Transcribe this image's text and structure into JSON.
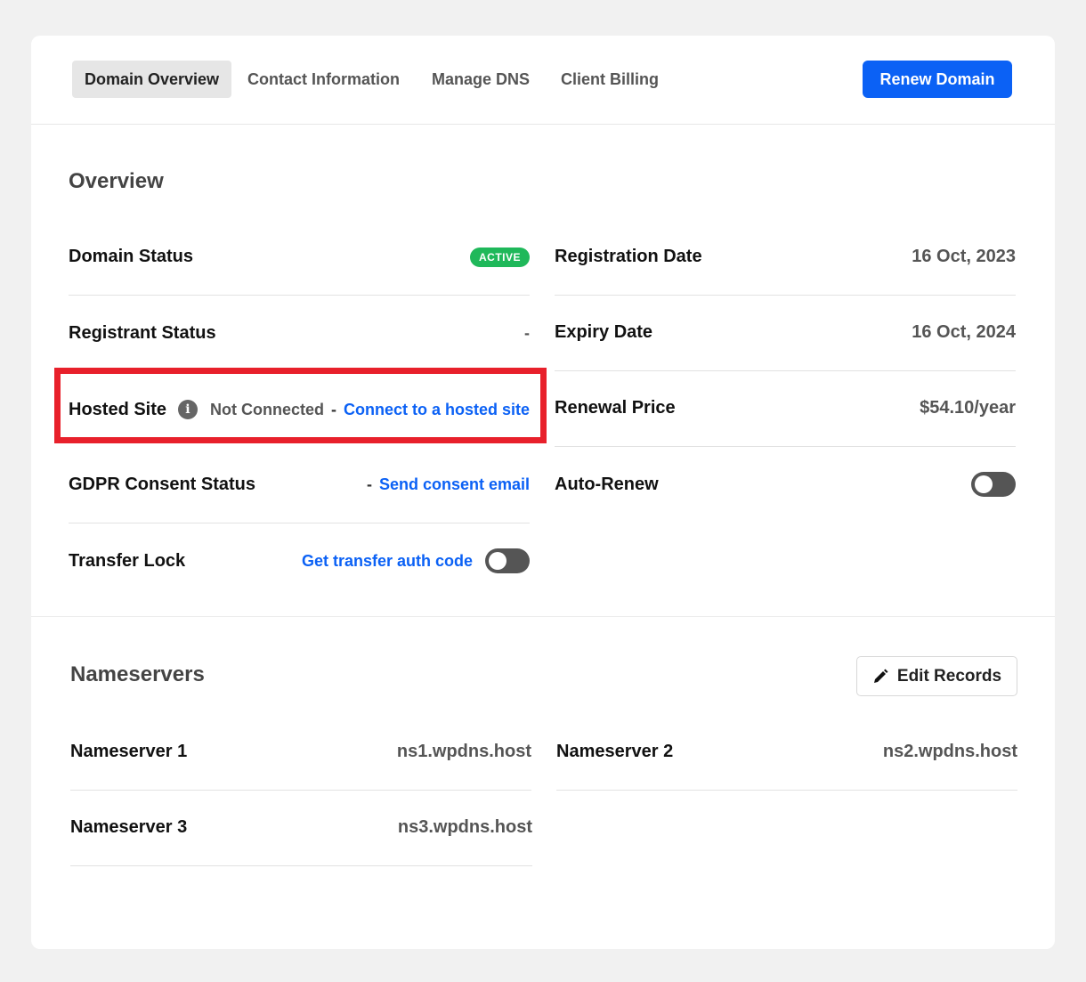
{
  "tabs": [
    {
      "label": "Domain Overview"
    },
    {
      "label": "Contact Information"
    },
    {
      "label": "Manage DNS"
    },
    {
      "label": "Client Billing"
    }
  ],
  "renew_button": "Renew Domain",
  "overview": {
    "title": "Overview",
    "domain_status": {
      "label": "Domain Status",
      "badge": "ACTIVE"
    },
    "registrant_status": {
      "label": "Registrant Status",
      "value": "-"
    },
    "hosted_site": {
      "label": "Hosted Site",
      "info_glyph": "i",
      "status": "Not Connected",
      "separator": "-",
      "link": "Connect to a hosted site"
    },
    "gdpr": {
      "label": "GDPR Consent Status",
      "separator": "-",
      "link": "Send consent email"
    },
    "transfer_lock": {
      "label": "Transfer Lock",
      "link": "Get transfer auth code",
      "toggle_on": false
    },
    "registration_date": {
      "label": "Registration Date",
      "value": "16 Oct, 2023"
    },
    "expiry_date": {
      "label": "Expiry Date",
      "value": "16 Oct, 2024"
    },
    "renewal_price": {
      "label": "Renewal Price",
      "value": "$54.10/year"
    },
    "auto_renew": {
      "label": "Auto-Renew",
      "toggle_on": false
    }
  },
  "nameservers": {
    "title": "Nameservers",
    "edit_button": "Edit Records",
    "edit_icon": "pencil-icon",
    "items": [
      {
        "label": "Nameserver 1",
        "value": "ns1.wpdns.host"
      },
      {
        "label": "Nameserver 2",
        "value": "ns2.wpdns.host"
      },
      {
        "label": "Nameserver 3",
        "value": "ns3.wpdns.host"
      }
    ]
  },
  "colors": {
    "accent": "#0b61f5",
    "active_badge": "#1fb85a",
    "highlight_box": "#e8202b"
  }
}
